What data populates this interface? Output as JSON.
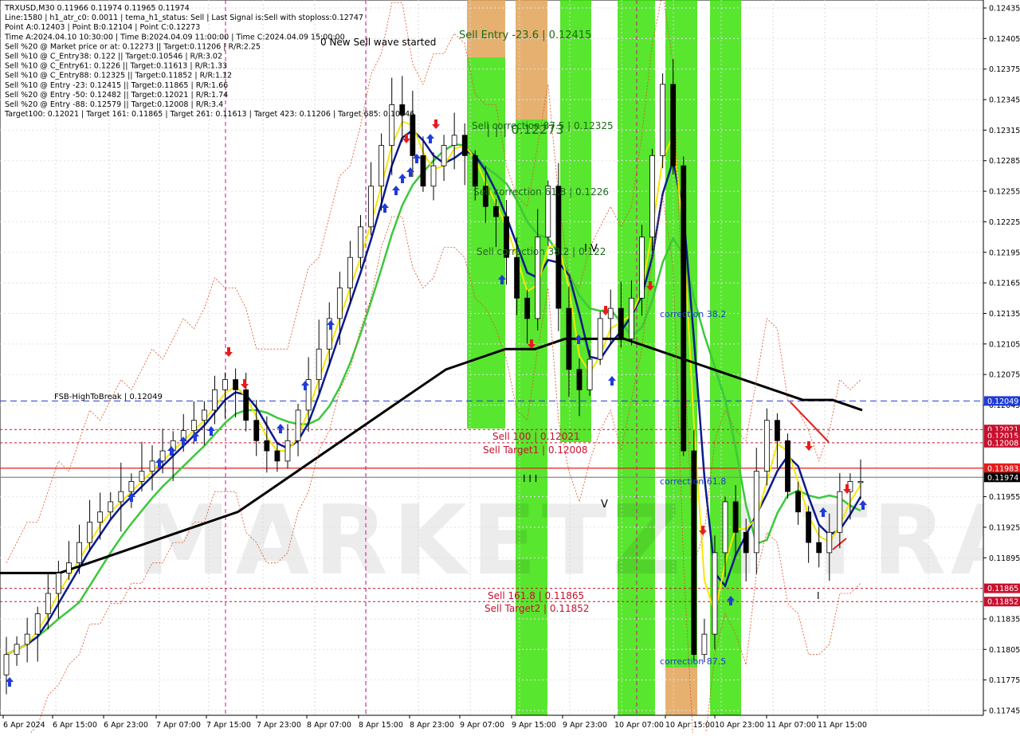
{
  "header": {
    "lines": [
      "TRXUSD,M30  0.11966 0.11974 0.11965 0.11974",
      "Line:1580 | h1_atr_c0: 0.0011 | tema_h1_status: Sell | Last Signal is:Sell with stoploss:0.12747",
      "Point A:0.12403 | Point B:0.12104 | Point C:0.12273",
      "Time A:2024.04.10 10:30:00 | Time B:2024.04.09 11:00:00 | Time C:2024.04.09 15:00:00",
      "Sell %20 @ Market price or at: 0.12273 || Target:0.11206 | R/R:2.25",
      "Sell %10 @ C_Entry38: 0.122 || Target:0.10546 | R/R:3.02",
      "Sell %10 @ C_Entry61: 0.1226 || Target:0.11613 | R/R:1.33",
      "Sell %10 @ C_Entry88: 0.12325 || Target:0.11852 | R/R:1.12",
      "Sell %10 @ Entry -23: 0.12415 || Target:0.11865 | R/R:1.66",
      "Sell %20 @ Entry -50: 0.12482 || Target:0.12021 | R/R:1.74",
      "Sell %20 @ Entry -88: 0.12579 || Target:0.12008 | R/R:3.4",
      "Target100: 0.12021 | Target 161: 0.11865 | Target 261: 0.11613 | Target 423: 0.11206 | Target 685: 0.10546"
    ]
  },
  "annotations": {
    "wave": "0 New Sell wave started",
    "sell_entry": "Sell Entry -23.6 | 0.12415",
    "sell_corr_875": "Sell correction 87.5 | 0.12325",
    "big_price": "| | | 0.12273",
    "sell_corr_618": "Sell correction 61.8 | 0.1226",
    "sell_corr_382": "Sell correction 38.2 | 0.122",
    "iv": "I V",
    "sell_100": "Sell 100 | 0.12021",
    "sell_target1": "Sell Target1 | 0.12008",
    "iii": "I I I",
    "sell_1618": "Sell 161.8 | 0.11865",
    "sell_target2": "Sell Target2 | 0.11852",
    "corr_382": "correction 38.2",
    "corr_618": "correction 61.8",
    "corr_875": "correction 87.5",
    "v": "V",
    "i": "I",
    "fsb": "FSB-HighToBreak | 0.12049",
    "watermark": "MARKETZ I TRADE"
  },
  "chart_data": {
    "type": "candlestick",
    "symbol": "TRXUSD",
    "timeframe": "M30",
    "ylim": [
      0.11745,
      0.12435
    ],
    "y_ticks": [
      "0.12435",
      "0.12405",
      "0.12375",
      "0.12345",
      "0.12315",
      "0.12285",
      "0.12255",
      "0.12225",
      "0.12195",
      "0.12165",
      "0.12135",
      "0.12105",
      "0.12075",
      "0.12045",
      "0.11955",
      "0.11925",
      "0.11895",
      "0.11835",
      "0.11805",
      "0.11775",
      "0.11745"
    ],
    "x_ticks": [
      "6 Apr 2024",
      "6 Apr 15:00",
      "6 Apr 23:00",
      "7 Apr 07:00",
      "7 Apr 15:00",
      "7 Apr 23:00",
      "8 Apr 07:00",
      "8 Apr 15:00",
      "8 Apr 23:00",
      "9 Apr 07:00",
      "9 Apr 15:00",
      "9 Apr 23:00",
      "10 Apr 07:00",
      "10 Apr 15:00",
      "10 Apr 23:00",
      "11 Apr 07:00",
      "11 Apr 15:00"
    ],
    "price_tags": [
      {
        "value": "0.12049",
        "color": "#1f3bd8"
      },
      {
        "value": "0.12021",
        "color": "#c8102e"
      },
      {
        "value": "0.12015",
        "color": "#c8102e"
      },
      {
        "value": "0.12008",
        "color": "#c8102e"
      },
      {
        "value": "0.11983",
        "color": "#e81b1b"
      },
      {
        "value": "0.11974",
        "color": "#000000"
      },
      {
        "value": "0.11865",
        "color": "#c8102e"
      },
      {
        "value": "0.11852",
        "color": "#c8102e"
      }
    ],
    "levels": [
      {
        "name": "FSB-HighToBreak",
        "value": 0.12049,
        "color": "#1f3bd8",
        "style": "dashed"
      },
      {
        "name": "Sell 100",
        "value": 0.12021,
        "color": "#c8102e",
        "style": "dashed"
      },
      {
        "name": "Sell Target1",
        "value": 0.12008,
        "color": "#c8102e",
        "style": "dashed"
      },
      {
        "name": "stop",
        "value": 0.11983,
        "color": "#e81b1b",
        "style": "solid"
      },
      {
        "name": "current",
        "value": 0.11974,
        "color": "#888888",
        "style": "solid"
      },
      {
        "name": "Sell 161.8",
        "value": 0.11865,
        "color": "#c8102e",
        "style": "dashed"
      },
      {
        "name": "Sell Target2",
        "value": 0.11852,
        "color": "#c8102e",
        "style": "dashed"
      }
    ],
    "candles_close": [
      0.118,
      0.1181,
      0.1182,
      0.1184,
      0.1186,
      0.1188,
      0.1189,
      0.1191,
      0.1193,
      0.1194,
      0.1195,
      0.1196,
      0.1197,
      0.1198,
      0.1199,
      0.12,
      0.1201,
      0.1202,
      0.1203,
      0.1204,
      0.1206,
      0.1207,
      0.1206,
      0.1203,
      0.1201,
      0.12,
      0.1199,
      0.1201,
      0.1204,
      0.1207,
      0.121,
      0.1213,
      0.1216,
      0.1219,
      0.1222,
      0.1226,
      0.123,
      0.1234,
      0.1233,
      0.1229,
      0.1226,
      0.1228,
      0.123,
      0.1231,
      0.1229,
      0.1226,
      0.1224,
      0.1223,
      0.1219,
      0.1215,
      0.1213,
      0.1221,
      0.1226,
      0.1214,
      0.1208,
      0.1206,
      0.1209,
      0.1213,
      0.1214,
      0.1211,
      0.1215,
      0.1221,
      0.1229,
      0.1236,
      0.1228,
      0.12,
      0.118,
      0.1182,
      0.119,
      0.1195,
      0.1192,
      0.119,
      0.1198,
      0.1203,
      0.1201,
      0.1196,
      0.1194,
      0.1191,
      0.119,
      0.1192,
      0.1196,
      0.1197,
      0.1197
    ],
    "ema_black": [
      0.1188,
      0.1188,
      0.1188,
      0.1189,
      0.119,
      0.1191,
      0.1192,
      0.1193,
      0.1194,
      0.1196,
      0.1198,
      0.12,
      0.1202,
      0.1204,
      0.1206,
      0.1208,
      0.1209,
      0.121,
      0.121,
      0.1211,
      0.1211,
      0.1211,
      0.121,
      0.1209,
      0.1208,
      0.1207,
      0.1206,
      0.1205,
      0.1205,
      0.1204
    ]
  },
  "colors": {
    "green_zone": "#33e000",
    "orange_zone": "#e0a050",
    "ema_black": "#000000",
    "ema_green": "#3cc83c",
    "ema_navy": "#0a1a8a",
    "ema_yellow": "#f5e800",
    "channel_red": "#e05020"
  }
}
